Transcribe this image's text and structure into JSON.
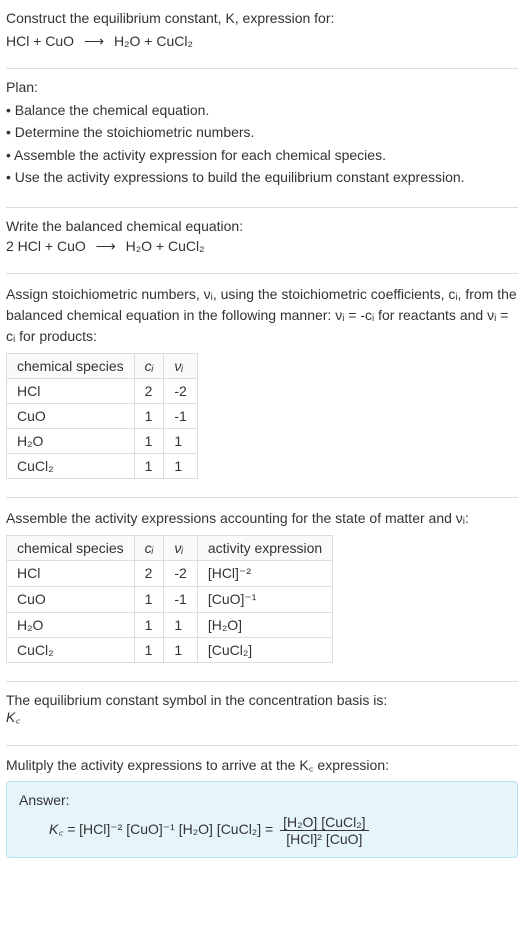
{
  "prompt": {
    "line1": "Construct the equilibrium constant, K, expression for:",
    "reaction_lhs": "HCl + CuO",
    "reaction_rhs": "H₂O + CuCl₂"
  },
  "plan": {
    "heading": "Plan:",
    "items": [
      "• Balance the chemical equation.",
      "• Determine the stoichiometric numbers.",
      "• Assemble the activity expression for each chemical species.",
      "• Use the activity expressions to build the equilibrium constant expression."
    ]
  },
  "balanced": {
    "heading": "Write the balanced chemical equation:",
    "lhs": "2 HCl + CuO",
    "rhs": "H₂O + CuCl₂"
  },
  "stoich": {
    "intro_a": "Assign stoichiometric numbers, νᵢ, using the stoichiometric coefficients, cᵢ, from the balanced chemical equation in the following manner: νᵢ = -cᵢ for reactants and νᵢ = cᵢ for products:",
    "headers": [
      "chemical species",
      "cᵢ",
      "νᵢ"
    ],
    "rows": [
      {
        "species": "HCl",
        "c": "2",
        "v": "-2"
      },
      {
        "species": "CuO",
        "c": "1",
        "v": "-1"
      },
      {
        "species": "H₂O",
        "c": "1",
        "v": "1"
      },
      {
        "species": "CuCl₂",
        "c": "1",
        "v": "1"
      }
    ]
  },
  "activity": {
    "intro": "Assemble the activity expressions accounting for the state of matter and νᵢ:",
    "headers": [
      "chemical species",
      "cᵢ",
      "νᵢ",
      "activity expression"
    ],
    "rows": [
      {
        "species": "HCl",
        "c": "2",
        "v": "-2",
        "expr": "[HCl]⁻²"
      },
      {
        "species": "CuO",
        "c": "1",
        "v": "-1",
        "expr": "[CuO]⁻¹"
      },
      {
        "species": "H₂O",
        "c": "1",
        "v": "1",
        "expr": "[H₂O]"
      },
      {
        "species": "CuCl₂",
        "c": "1",
        "v": "1",
        "expr": "[CuCl₂]"
      }
    ]
  },
  "basis": {
    "line1": "The equilibrium constant symbol in the concentration basis is:",
    "symbol": "K꜀"
  },
  "multiply": {
    "line1": "Mulitply the activity expressions to arrive at the K꜀ expression:"
  },
  "answer": {
    "label": "Answer:",
    "lhs": "K꜀ =",
    "product": "[HCl]⁻² [CuO]⁻¹ [H₂O] [CuCl₂] =",
    "frac_num": "[H₂O] [CuCl₂]",
    "frac_den": "[HCl]² [CuO]"
  },
  "chart_data": {
    "type": "table",
    "tables": [
      {
        "title": "Stoichiometric numbers",
        "columns": [
          "chemical species",
          "c_i",
          "ν_i"
        ],
        "rows": [
          [
            "HCl",
            2,
            -2
          ],
          [
            "CuO",
            1,
            -1
          ],
          [
            "H2O",
            1,
            1
          ],
          [
            "CuCl2",
            1,
            1
          ]
        ]
      },
      {
        "title": "Activity expressions",
        "columns": [
          "chemical species",
          "c_i",
          "ν_i",
          "activity expression"
        ],
        "rows": [
          [
            "HCl",
            2,
            -2,
            "[HCl]^-2"
          ],
          [
            "CuO",
            1,
            -1,
            "[CuO]^-1"
          ],
          [
            "H2O",
            1,
            1,
            "[H2O]"
          ],
          [
            "CuCl2",
            1,
            1,
            "[CuCl2]"
          ]
        ]
      }
    ],
    "reaction_unbalanced": "HCl + CuO -> H2O + CuCl2",
    "reaction_balanced": "2 HCl + CuO -> H2O + CuCl2",
    "equilibrium_constant": "Kc = ([H2O][CuCl2]) / ([HCl]^2 [CuO])"
  }
}
